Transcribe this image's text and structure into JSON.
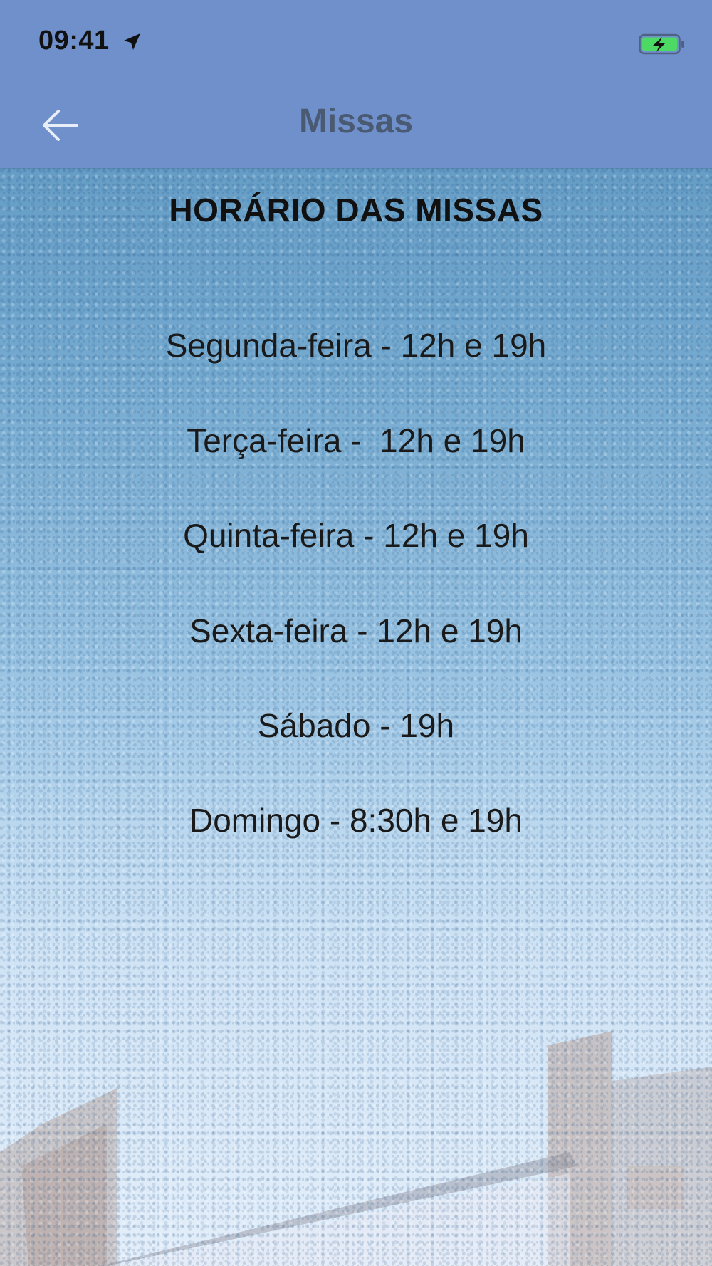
{
  "status_bar": {
    "time": "09:41",
    "icons": [
      "location-arrow-icon",
      "battery-charging-icon"
    ],
    "battery_color": "#4cd964"
  },
  "nav": {
    "title": "Missas",
    "back_icon": "arrow-left-icon",
    "background": "#7090cc"
  },
  "page": {
    "heading": "HORÁRIO DAS MISSAS",
    "schedule": [
      "Segunda-feira - 12h e 19h",
      "Terça-feira -  12h e 19h",
      "Quinta-feira - 12h e 19h",
      "Sexta-feira - 12h e 19h",
      "Sábado - 19h",
      "Domingo - 8:30h e 19h"
    ]
  }
}
